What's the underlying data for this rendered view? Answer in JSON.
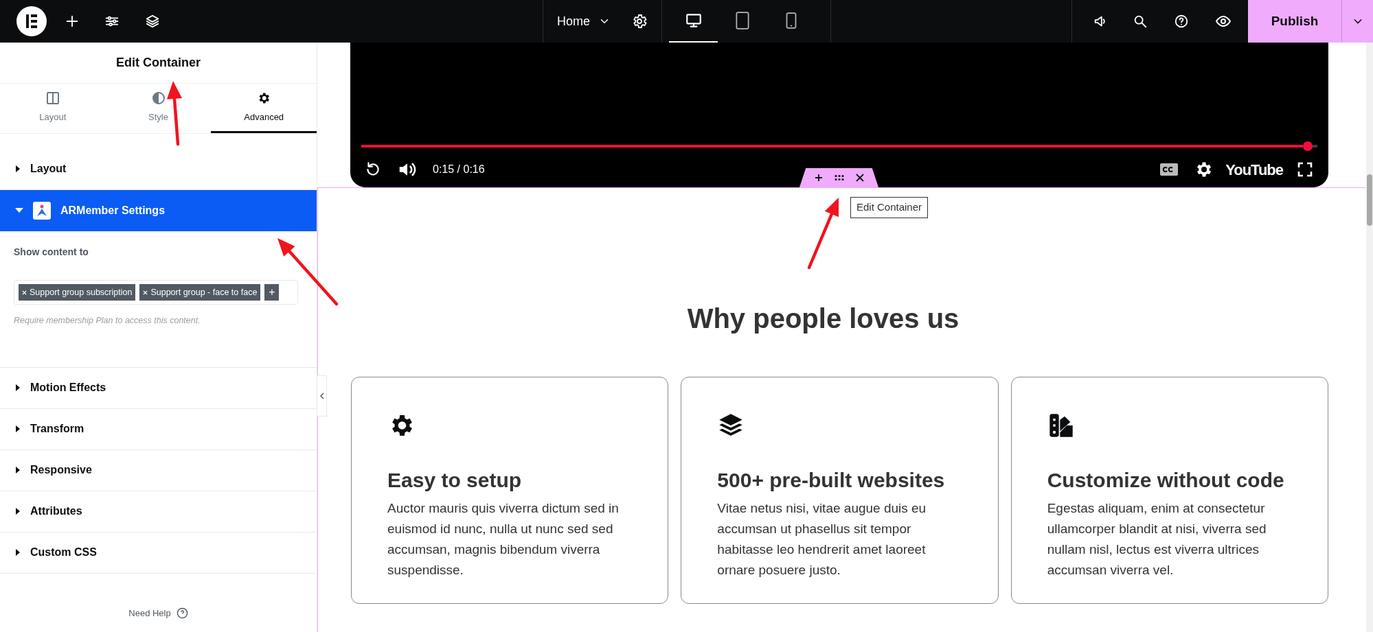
{
  "top_bar": {
    "page": "Home",
    "devices": [
      {
        "kind": "desktop",
        "selected": true
      },
      {
        "kind": "tablet",
        "selected": false
      },
      {
        "kind": "mobile",
        "selected": false
      }
    ],
    "publish": "Publish"
  },
  "panel": {
    "title": "Edit Container",
    "tabs": [
      {
        "label": "Layout",
        "kind": "columns",
        "selected": false
      },
      {
        "label": "Style",
        "kind": "contrast",
        "selected": false
      },
      {
        "label": "Advanced",
        "kind": "gear",
        "selected": true
      }
    ],
    "sections": [
      {
        "label": "Layout",
        "expanded": false
      },
      {
        "label": "ARMember Settings",
        "expanded": true,
        "kind": "plugin"
      },
      {
        "label": "Motion Effects",
        "expanded": false
      },
      {
        "label": "Transform",
        "expanded": false
      },
      {
        "label": "Responsive",
        "expanded": false
      },
      {
        "label": "Attributes",
        "expanded": false
      },
      {
        "label": "Custom CSS",
        "expanded": false
      }
    ],
    "show_content_label": "Show content to",
    "tags": [
      "Support group subscription",
      "Support group - face to face"
    ],
    "add_tag": "+",
    "hint": "Require membership Plan to access this content.",
    "need_help": "Need Help"
  },
  "video": {
    "time": "0:15 / 0:16",
    "level": 0.99,
    "brand": "YouTube"
  },
  "container_toolbar": {
    "tooltip": "Edit Container"
  },
  "heading": "Why people loves us",
  "cards": [
    {
      "kind": "gear",
      "title": "Easy to setup",
      "text": "Auctor mauris quis viverra dictum sed in euismod id nunc, nulla ut nunc sed sed accumsan, magnis bibendum viverra suspendisse."
    },
    {
      "kind": "layers",
      "title": "500+ pre-built websites",
      "text": "Vitae netus nisi, vitae augue duis eu accumsan ut phasellus sit tempor habitasse leo hendrerit amet laoreet ornare posuere justo."
    },
    {
      "kind": "swatches",
      "title": "Customize without code",
      "text": "Egestas aliquam, enim at consectetur ullamcorper blandit at nisi, viverra sed nullam nisl, lectus est viverra ultrices accumsan viverra vel."
    }
  ]
}
